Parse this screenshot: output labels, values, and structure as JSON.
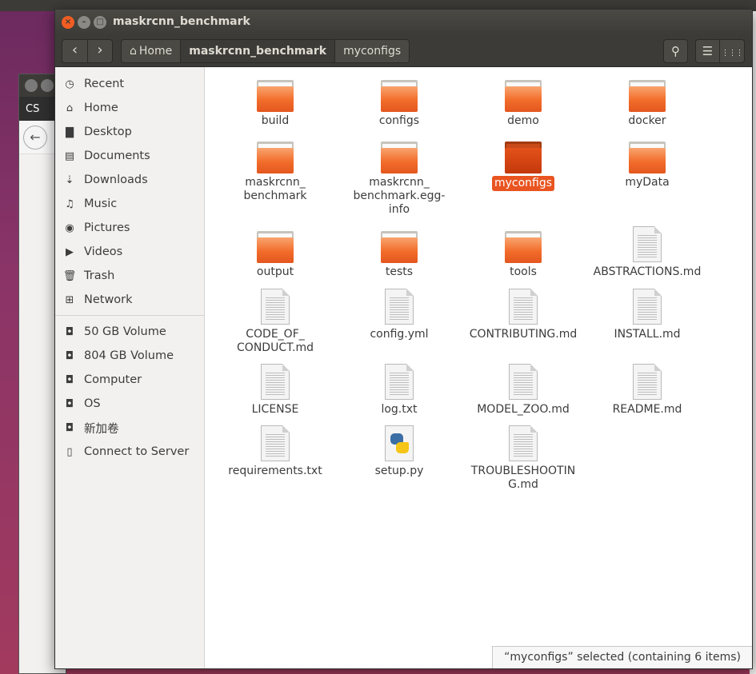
{
  "window": {
    "title": "maskrcnn_benchmark"
  },
  "background": {
    "tab_label": "CS"
  },
  "toolbar": {
    "back_label": "‹",
    "forward_label": "›",
    "breadcrumbs": [
      "Home",
      "maskrcnn_benchmark",
      "myconfigs"
    ],
    "search_label": "⚲",
    "list_view_label": "☰",
    "grid_view_label": "⋮⋮⋮"
  },
  "sidebar": {
    "places": [
      {
        "label": "Recent",
        "icon": "clock-icon",
        "glyph": "◷"
      },
      {
        "label": "Home",
        "icon": "home-icon",
        "glyph": "⌂"
      },
      {
        "label": "Desktop",
        "icon": "desktop-icon",
        "glyph": "▇"
      },
      {
        "label": "Documents",
        "icon": "documents-icon",
        "glyph": "▤"
      },
      {
        "label": "Downloads",
        "icon": "downloads-icon",
        "glyph": "⇣"
      },
      {
        "label": "Music",
        "icon": "music-icon",
        "glyph": "♫"
      },
      {
        "label": "Pictures",
        "icon": "camera-icon",
        "glyph": "◉"
      },
      {
        "label": "Videos",
        "icon": "video-icon",
        "glyph": "▶"
      },
      {
        "label": "Trash",
        "icon": "trash-icon",
        "glyph": "🗑"
      },
      {
        "label": "Network",
        "icon": "network-icon",
        "glyph": "⊞"
      }
    ],
    "devices": [
      {
        "label": "50 GB Volume",
        "icon": "drive-icon",
        "glyph": "◘"
      },
      {
        "label": "804 GB Volume",
        "icon": "drive-icon",
        "glyph": "◘"
      },
      {
        "label": "Computer",
        "icon": "computer-icon",
        "glyph": "◘"
      },
      {
        "label": "OS",
        "icon": "drive-icon",
        "glyph": "◘"
      },
      {
        "label": "新加卷",
        "icon": "drive-icon",
        "glyph": "◘"
      },
      {
        "label": "Connect to Server",
        "icon": "server-icon",
        "glyph": "▯"
      }
    ]
  },
  "files": [
    {
      "name": "build",
      "type": "folder"
    },
    {
      "name": "configs",
      "type": "folder"
    },
    {
      "name": "demo",
      "type": "folder"
    },
    {
      "name": "docker",
      "type": "folder"
    },
    {
      "name": "maskrcnn_\nbenchmark",
      "type": "folder"
    },
    {
      "name": "maskrcnn_\nbenchmark.egg-\ninfo",
      "type": "folder"
    },
    {
      "name": "myconfigs",
      "type": "folder",
      "selected": true
    },
    {
      "name": "myData",
      "type": "folder"
    },
    {
      "name": "output",
      "type": "folder"
    },
    {
      "name": "tests",
      "type": "folder"
    },
    {
      "name": "tools",
      "type": "folder"
    },
    {
      "name": "ABSTRACTIONS.md",
      "type": "doc"
    },
    {
      "name": "CODE_OF_\nCONDUCT.md",
      "type": "doc"
    },
    {
      "name": "config.yml",
      "type": "doc"
    },
    {
      "name": "CONTRIBUTING.md",
      "type": "doc"
    },
    {
      "name": "INSTALL.md",
      "type": "doc"
    },
    {
      "name": "LICENSE",
      "type": "doc"
    },
    {
      "name": "log.txt",
      "type": "doc"
    },
    {
      "name": "MODEL_ZOO.md",
      "type": "doc"
    },
    {
      "name": "README.md",
      "type": "doc"
    },
    {
      "name": "requirements.txt",
      "type": "doc"
    },
    {
      "name": "setup.py",
      "type": "python"
    },
    {
      "name": "TROUBLESHOOTIN\nG.md",
      "type": "doc"
    }
  ],
  "status": {
    "text": "“myconfigs” selected  (containing 6 items)"
  },
  "colors": {
    "accent": "#e95420",
    "titlebar": "#3c3b37",
    "sidebar": "#f2f1f0"
  }
}
